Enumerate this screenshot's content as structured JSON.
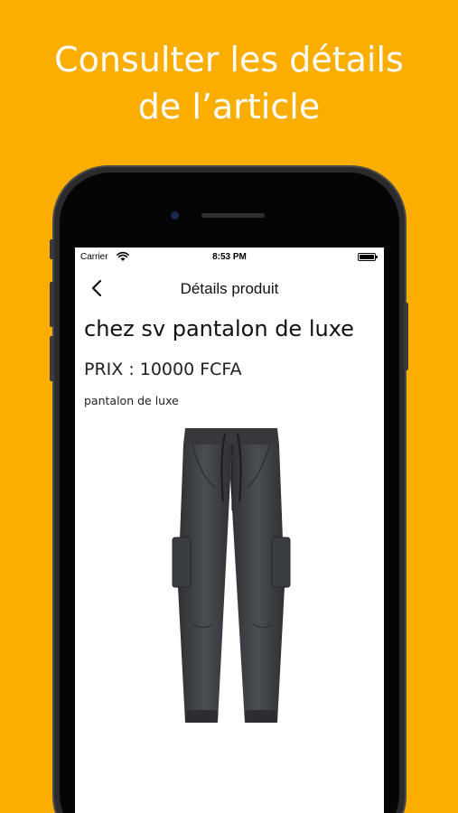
{
  "headline": {
    "line1": "Consulter les détails",
    "line2": "de l’article"
  },
  "status_bar": {
    "carrier": "Carrier",
    "time": "8:53 PM"
  },
  "nav": {
    "title": "Détails produit",
    "back_icon": "chevron-left-icon"
  },
  "product": {
    "title": "chez sv pantalon de luxe",
    "price": "PRIX : 10000 FCFA",
    "description": "pantalon de luxe",
    "image": "cargo-pants-image"
  },
  "colors": {
    "background": "#FBAE00",
    "headline_text": "#FFFFFF",
    "pants": "#3f4246"
  }
}
